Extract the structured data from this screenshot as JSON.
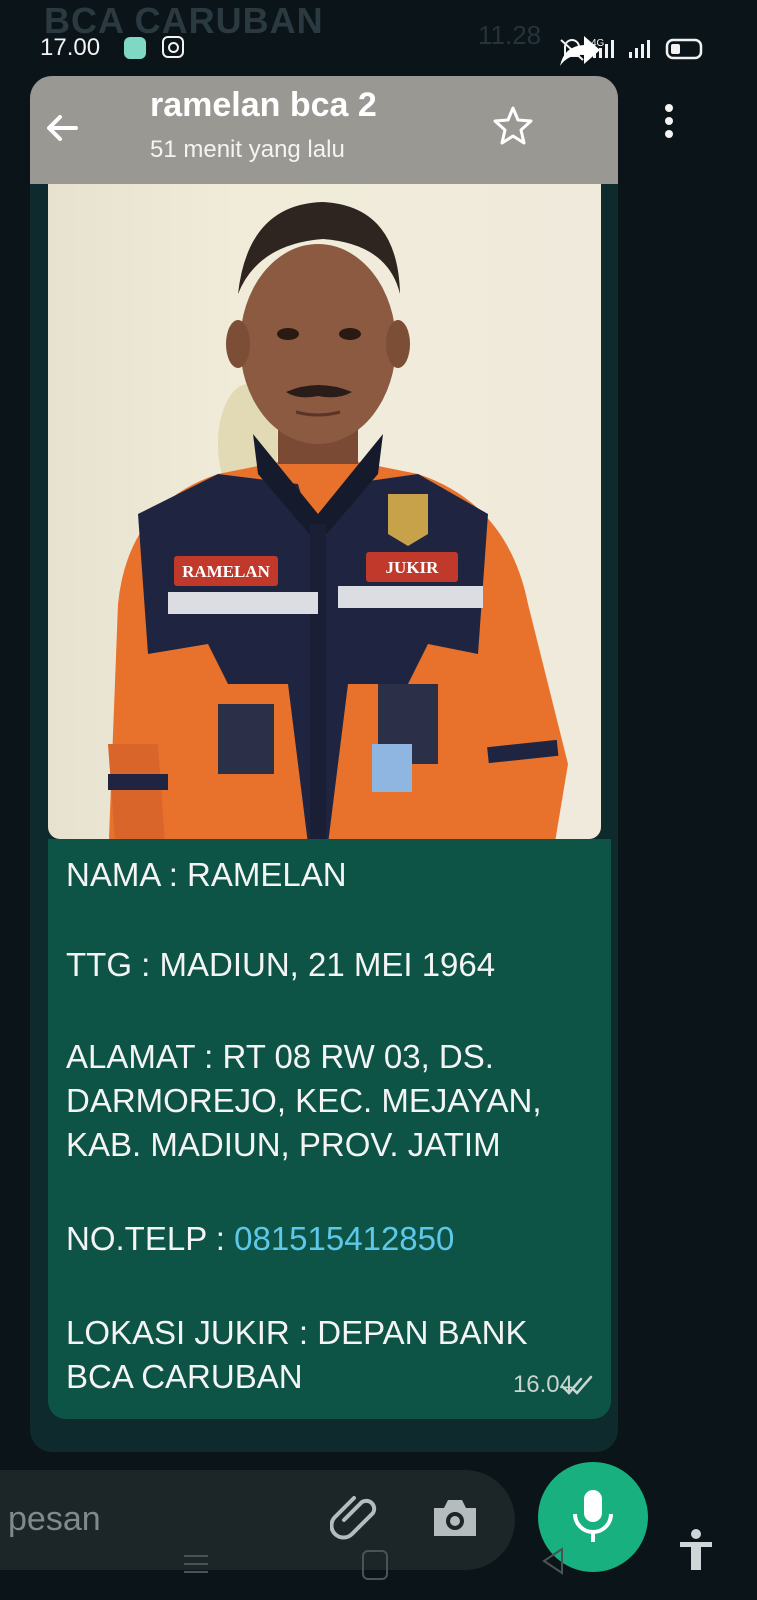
{
  "background_chat": {
    "title": "BCA CARUBAN",
    "time": "11.28"
  },
  "status_bar": {
    "time": "17.00",
    "network": "4G"
  },
  "header": {
    "contact_name": "ramelan bca 2",
    "subtitle": "51 menit yang lalu"
  },
  "caption": {
    "lines": [
      "NAMA : RAMELAN",
      "TTG : MADIUN, 21 MEI 1964",
      "ALAMAT : RT 08 RW 03, DS.",
      "DARMOREJO, KEC. MEJAYAN,",
      "KAB. MADIUN, PROV. JATIM",
      "LOKASI JUKIR : DEPAN BANK",
      "BCA CARUBAN"
    ],
    "phone_label": "NO.TELP : ",
    "phone_number": "081515412850",
    "time": "16.04"
  },
  "photo": {
    "badge_name": "RAMELAN",
    "badge_role": "JUKIR"
  },
  "input": {
    "placeholder": "pesan"
  },
  "colors": {
    "bubble": "#0d5446",
    "header": "#9a9893",
    "link": "#5ec8ea",
    "mic": "#17b07e"
  }
}
